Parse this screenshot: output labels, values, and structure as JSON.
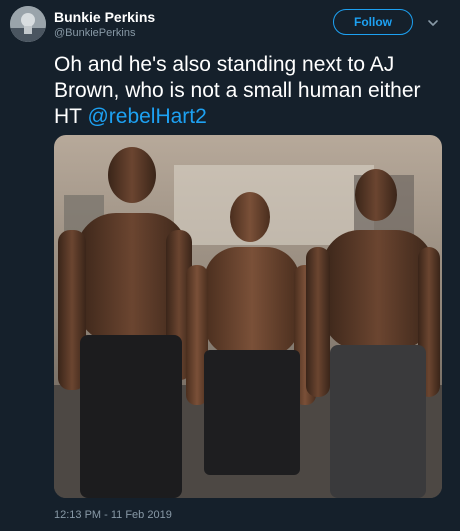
{
  "author": {
    "display_name": "Bunkie Perkins",
    "handle": "@BunkiePerkins",
    "avatar_icon": "profile-avatar-icon"
  },
  "follow_label": "Follow",
  "tweet": {
    "text": "Oh and he's also standing next to AJ Brown, who is not a small human either HT ",
    "mention": "@rebelHart2"
  },
  "timestamp": "12:13 PM - 11 Feb 2019",
  "colors": {
    "background": "#15202b",
    "accent": "#1da1f2",
    "secondary_text": "#8899a6"
  },
  "icons": [
    "chevron-down-icon"
  ]
}
